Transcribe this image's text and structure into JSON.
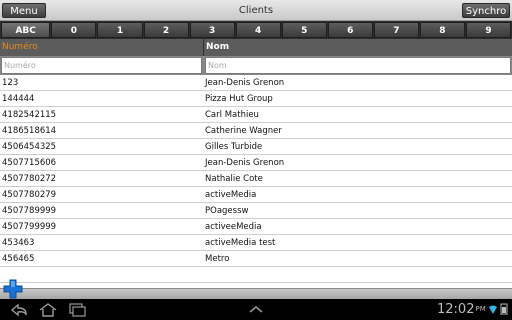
{
  "titlebar": {
    "menu_label": "Menu",
    "title": "Clients",
    "synchro_label": "Synchro"
  },
  "alpha": [
    "ABC",
    "0",
    "1",
    "2",
    "3",
    "4",
    "5",
    "6",
    "7",
    "8",
    "9"
  ],
  "columns": {
    "numero": "Numéro",
    "nom": "Nom"
  },
  "filters": {
    "numero_placeholder": "Numéro",
    "nom_placeholder": "Nom"
  },
  "rows": [
    {
      "numero": "123",
      "nom": "Jean-Denis Grenon"
    },
    {
      "numero": "144444",
      "nom": "Pizza Hut Group"
    },
    {
      "numero": "4182542115",
      "nom": "Carl Mathieu"
    },
    {
      "numero": "4186518614",
      "nom": "Catherine Wagner"
    },
    {
      "numero": "4506454325",
      "nom": "Gilles Turbide"
    },
    {
      "numero": "4507715606",
      "nom": "Jean-Denis Grenon"
    },
    {
      "numero": "4507780272",
      "nom": "Nathalie Cote"
    },
    {
      "numero": "4507780279",
      "nom": "activeMedia"
    },
    {
      "numero": "4507789999",
      "nom": "POagessw"
    },
    {
      "numero": "4507799999",
      "nom": "activeeMedia"
    },
    {
      "numero": "453463",
      "nom": "activeMedia test"
    },
    {
      "numero": "456465",
      "nom": "Metro"
    },
    {
      "numero": "",
      "nom": ""
    }
  ],
  "statusbar": {
    "time": "12:02",
    "time_suffix": "PM"
  },
  "icons": {
    "add": "plus-icon",
    "back": "back-icon",
    "home": "home-icon",
    "recents": "recent-apps-icon",
    "up": "chevron-up-icon",
    "wifi": "wifi-icon",
    "battery": "battery-icon"
  },
  "colors": {
    "accent_header": "#e8891a",
    "fab": "#1a73d4"
  }
}
